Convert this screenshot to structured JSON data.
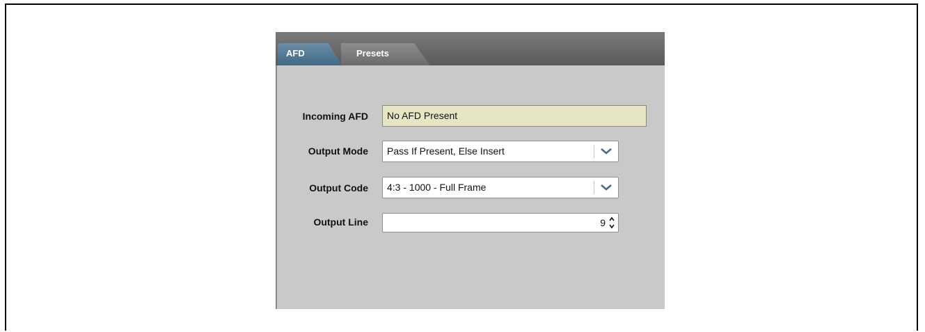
{
  "tabs": [
    {
      "label": "AFD",
      "active": true
    },
    {
      "label": "Presets",
      "active": false
    }
  ],
  "form": {
    "incoming_afd": {
      "label": "Incoming AFD",
      "value": "No AFD Present"
    },
    "output_mode": {
      "label": "Output Mode",
      "value": "Pass If Present, Else Insert"
    },
    "output_code": {
      "label": "Output Code",
      "value": "4:3 - 1000 - Full Frame"
    },
    "output_line": {
      "label": "Output Line",
      "value": "9"
    }
  },
  "colors": {
    "active_tab": "#4f7894",
    "inactive_tab": "#7b7b7b",
    "panel_bg": "#c9c9c9",
    "readonly_field_bg": "#e7e6c4"
  },
  "icons": {
    "dropdown": "chevron-down-icon",
    "spinner": "spinner-arrows-icon"
  }
}
